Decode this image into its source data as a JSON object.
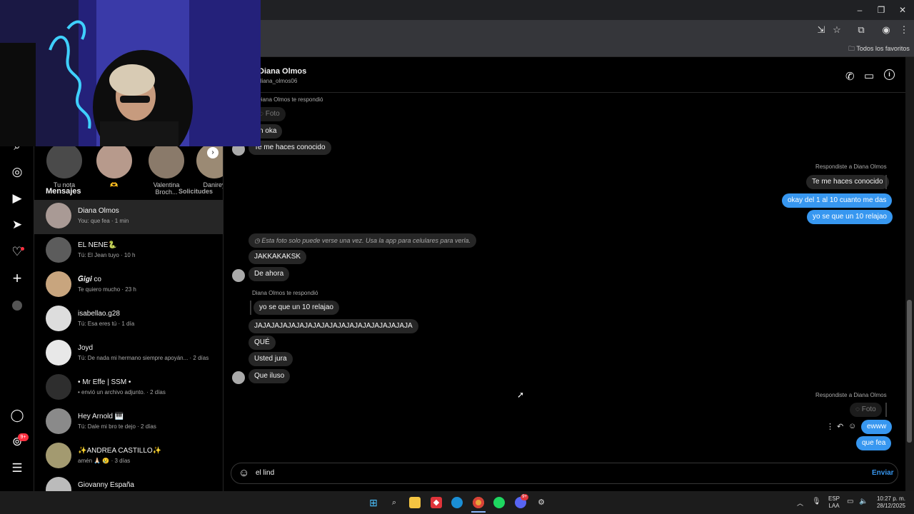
{
  "browser": {
    "bookmark_folder": "Todos los favoritos",
    "window_controls": [
      "minimize-icon",
      "restore-icon",
      "close-icon"
    ]
  },
  "rail": {
    "icons": [
      "search-icon",
      "explore-icon",
      "reels-icon",
      "messages-icon",
      "notifications-icon",
      "create-icon",
      "profile-icon",
      "threads-icon",
      "meta-icon",
      "menu-icon"
    ],
    "meta_badge": "9+"
  },
  "stories": [
    {
      "label": "Tu nota"
    },
    {
      "label": "🫶"
    },
    {
      "label": "Valentina Broch..."
    },
    {
      "label": "Danirey"
    }
  ],
  "list": {
    "header": "Mensajes",
    "requests": "Solicitudes",
    "conversations": [
      {
        "name": "Diana Olmos",
        "preview": "You: que fea · 1 min"
      },
      {
        "name": "EL NENE🐍",
        "preview": "Tú: El Jean tuyo · 10 h"
      },
      {
        "name": "𝑮𝒊𝒈𝒊 co",
        "preview": "Te quiero mucho · 23 h"
      },
      {
        "name": "isabellao.g28",
        "preview": "Tú: Esa eres tú · 1 día"
      },
      {
        "name": "Joyd",
        "preview": "Tú: De nada mi hermano siempre apoyán... · 2 días"
      },
      {
        "name": "• Mr Effe | SSM •",
        "preview": "• envió un archivo adjunto. · 2 días"
      },
      {
        "name": "Hey Arnold 🎹",
        "preview": "Tú: Dale mi bro te dejo · 2 días"
      },
      {
        "name": "✨ANDREA CASTILLO✨",
        "preview": "amén 🙏🏻 😢 · 3 días"
      },
      {
        "name": "Giovanny España",
        "preview": ""
      }
    ]
  },
  "chat": {
    "name": "Diana Olmos",
    "username": "diana_olmos06",
    "header_icons": [
      "phone-icon",
      "video-icon",
      "info-icon"
    ],
    "reply_label_in": "Diana Olmos te respondió",
    "reply_label_out": "Respondiste a Diana Olmos",
    "photo_label": "Foto",
    "messages_top_in": [
      "n oka",
      "Te me haces conocido"
    ],
    "out_quote": "Te me haces conocido",
    "out_block_1": [
      "okay del 1 al 10 cuanto me das",
      "yo se que un 10 relajao"
    ],
    "view_once": "Esta foto solo puede verse una vez. Usa la app para celulares para verla.",
    "in_block_2": [
      "JAKKAKAKSK",
      "De ahora"
    ],
    "quote_in": "yo se que un 10 relajao",
    "in_block_3": [
      "JAJAJAJAJAJAJAJAJAJAJAJAJAJAJAJAJAJAJA",
      "QUÉ",
      "Usted jura",
      "Que iluso"
    ],
    "out_block_2": [
      "ewww",
      "que fea"
    ],
    "composer_value": "el lind",
    "send_label": "Enviar"
  },
  "taskbar": {
    "lang": "ESP",
    "lang2": "LAA",
    "time": "10:27 p. m.",
    "date": "28/12/2025",
    "discord_badge": "9+"
  }
}
